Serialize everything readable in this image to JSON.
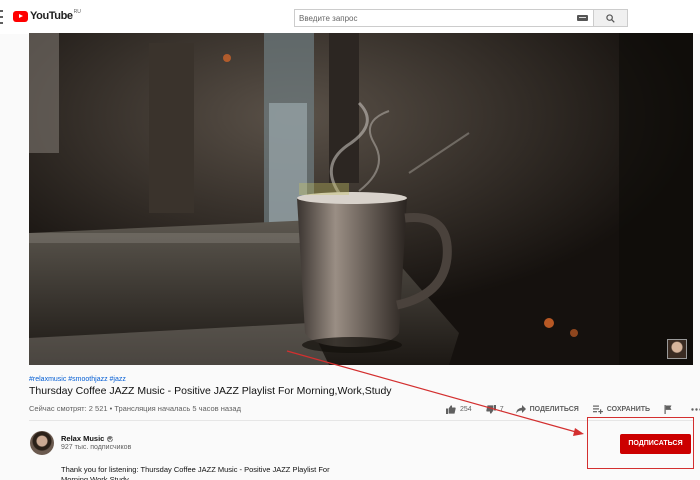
{
  "header": {
    "logo_text": "YouTube",
    "logo_region": "RU",
    "search_placeholder": "Введите запрос"
  },
  "video": {
    "tags": "#relaxmusic #smoothjazz #jazz",
    "title": "Thursday Coffee JAZZ Music - Positive JAZZ Playlist For Morning,Work,Study",
    "meta": "Сейчас смотрят: 2 521 • Трансляция началась 5 часов назад"
  },
  "actions": {
    "likes": "254",
    "dislikes": "7",
    "share_label": "ПОДЕЛИТЬСЯ",
    "save_label": "СОХРАНИТЬ"
  },
  "channel": {
    "name": "Relax Music",
    "subscribers": "927 тыс. подписчиков",
    "subscribe_label": "ПОДПИСАТЬСЯ"
  },
  "description": "Thank you for listening: Thursday Coffee JAZZ Music - Positive JAZZ Playlist For Morning,Work,Study",
  "colors": {
    "accent": "#cc0000",
    "link": "#065fd4",
    "annotation": "#d32f2f"
  },
  "icons": [
    "menu-icon",
    "youtube-logo-icon",
    "keyboard-icon",
    "search-icon",
    "like-icon",
    "dislike-icon",
    "share-icon",
    "save-playlist-icon",
    "flag-icon",
    "more-icon",
    "verified-icon"
  ]
}
